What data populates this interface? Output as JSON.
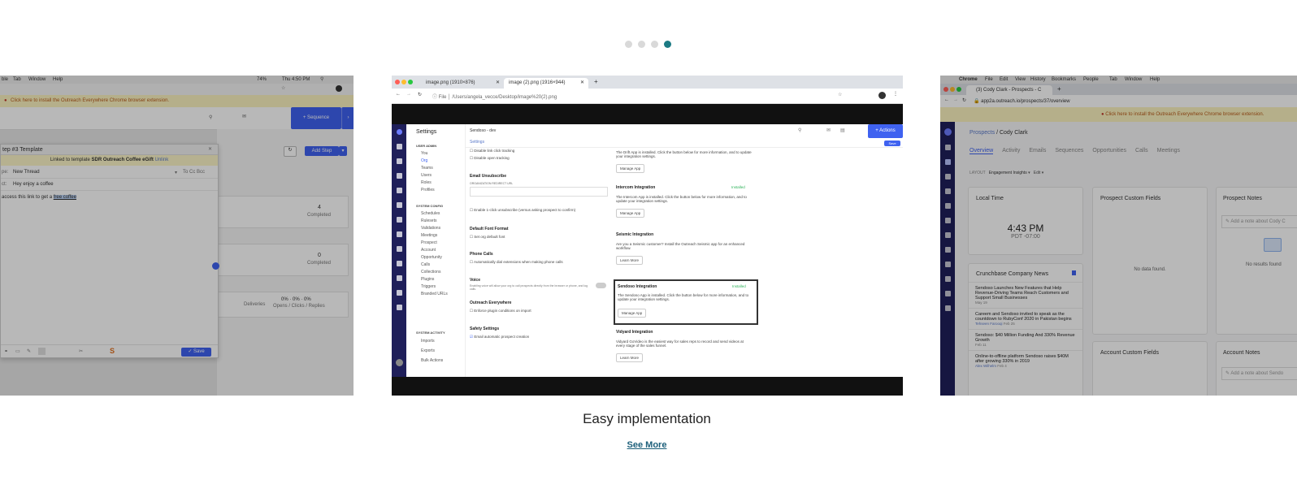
{
  "carousel": {
    "dots": [
      {
        "label": "slide-1",
        "active": false
      },
      {
        "label": "slide-2",
        "active": false
      },
      {
        "label": "slide-3",
        "active": false
      },
      {
        "label": "slide-4",
        "active": true
      }
    ],
    "caption": "Easy implementation",
    "see_more": "See More"
  },
  "left_slide": {
    "menubar": [
      "ble",
      "Tab",
      "Window",
      "Help"
    ],
    "clock": "Thu 4:50 PM",
    "battery": "74%",
    "banner": "Click here to install the Outreach Everywhere Chrome browser extension.",
    "sequence_btn": "+ Sequence",
    "add_step_btn": "Add Step",
    "modal_title": "tep #3 Template",
    "linked_prefix": "Linked to template",
    "linked_template": "SDR Outreach Coffee eGift",
    "unlink": "Unlink",
    "thread_label": "pe:",
    "thread_value": "New Thread",
    "to_cc_bcc": "To  Cc  Bcc",
    "subject_label": "ct:",
    "subject_value": "Hey enjoy a coffee",
    "body_text": "access this link to get a",
    "body_link": "free coffee",
    "save_btn": "✓ Save",
    "stats": [
      {
        "value": "4",
        "label": "Completed"
      },
      {
        "value": "0",
        "label": "Completed"
      }
    ],
    "delivery_row": {
      "deliveries": "Deliveries",
      "values": "0%  ·  0%  ·  0%",
      "labels": "Opens / Clicks / Replies"
    }
  },
  "center_slide": {
    "tabs": [
      "image.png (1910×876)",
      "image (2).png (1916×944)"
    ],
    "url": "/Users/angela_vecce/Desktop/image%20(2).png",
    "settings_title": "Settings",
    "org_name": "Sendoso - dev",
    "breadcrumb": "Settings",
    "actions_btn": "+ Actions",
    "save_btn": "Save",
    "nav_sections": [
      {
        "heading": "USER ADMIN",
        "items": [
          "You",
          "Org",
          "Teams",
          "Users",
          "Roles",
          "Profiles"
        ]
      },
      {
        "heading": "SYSTEM CONFIG",
        "items": [
          "Schedules",
          "Rulesets",
          "Validations",
          "Meetings",
          "Prospect",
          "Account",
          "Opportunity",
          "Calls",
          "Collections",
          "Plugins",
          "Triggers",
          "Branded URLs"
        ]
      },
      {
        "heading": "SYSTEM ACTIVITY",
        "items": [
          "Imports",
          "Exports",
          "Bulk Actions"
        ]
      }
    ],
    "left_settings": [
      {
        "title": "",
        "lines": [
          "Disable link click tracking",
          "Disable open tracking"
        ]
      },
      {
        "title": "Email Unsubscribe",
        "lines": [
          "ORGANIZATION REDIRECT URL",
          "Enable 1-click unsubscribe (versus asking prospect to confirm)"
        ]
      },
      {
        "title": "Default Font Format",
        "lines": [
          "Set org default font"
        ]
      },
      {
        "title": "Phone Calls",
        "lines": [
          "Automatically dial extensions when making phone calls"
        ]
      },
      {
        "title": "Voice",
        "lines": [
          "Enabling voice will allow your org to call prospects directly from the browser or phone, and log calls."
        ]
      },
      {
        "title": "Outreach Everywhere",
        "lines": [
          "Enforce plugin conditions on import"
        ]
      },
      {
        "title": "Safety Settings",
        "lines": [
          "Email automatic prospect creation"
        ]
      }
    ],
    "integrations": [
      {
        "title": "",
        "desc": "The Drift App is installed. Click the button below for more information, and to update your integration settings.",
        "button": "Manage App",
        "status": ""
      },
      {
        "title": "Intercom Integration",
        "desc": "The Intercom App is installed. Click the button below for more information, and to update your integration settings.",
        "button": "Manage App",
        "status": "Installed"
      },
      {
        "title": "Seismic Integration",
        "desc": "Are you a Seismic customer? Install the Outreach Seismic app for an enhanced workflow.",
        "button": "Learn More",
        "status": ""
      },
      {
        "title": "Sendoso Integration",
        "desc": "The Sendoso App is installed. Click the button below for more information, and to update your integration settings.",
        "button": "Manage App",
        "status": "Installed"
      },
      {
        "title": "Vidyard Integration",
        "desc": "Vidyard GoVideo is the easiest way for sales reps to record and send videos at every stage of the sales funnel.",
        "button": "Learn More",
        "status": ""
      }
    ]
  },
  "right_slide": {
    "menubar": [
      "Chrome",
      "File",
      "Edit",
      "View",
      "History",
      "Bookmarks",
      "People",
      "Tab",
      "Window",
      "Help"
    ],
    "tab": "(3) Cody Clark - Prospects - C",
    "url": "app2a.outreach.io/prospects/37/overview",
    "banner": "Click here to install the Outreach Everywhere Chrome browser extension.",
    "breadcrumb_parent": "Prospects",
    "breadcrumb_current": "Cody Clark",
    "tabs": [
      "Overview",
      "Activity",
      "Emails",
      "Sequences",
      "Opportunities",
      "Calls",
      "Meetings"
    ],
    "layout_label": "LAYOUT",
    "layout_value": "Engagement Insights",
    "edit": "Edit",
    "local_time_title": "Local Time",
    "local_time": "4:43 PM",
    "timezone": "PDT -07:00",
    "custom_fields_title": "Prospect Custom Fields",
    "no_data": "No data found.",
    "notes_title": "Prospect Notes",
    "notes_placeholder": "Add a note about Cody C",
    "no_results": "No results found",
    "news_title": "Crunchbase Company News",
    "news": [
      {
        "headline": "Sendoso Launches New Features that Help Revenue-Driving Teams Reach Customers and Support Small Businesses",
        "author": "",
        "date": "May 19"
      },
      {
        "headline": "Careem and Sendoso invited to speak as the countdown to RubyConf 2020 in Pakistan begins",
        "author": "Tehseen Farooqi",
        "date": "Feb 25"
      },
      {
        "headline": "Sendoso: $40 Million Funding And 330% Revenue Growth",
        "author": "",
        "date": "Feb 11"
      },
      {
        "headline": "Online-to-offline platform Sendoso raises $40M after growing 330% in 2019",
        "author": "Alex Wilhelm",
        "date": "Feb 4"
      }
    ],
    "account_custom_fields": "Account Custom Fields",
    "account_notes": "Account Notes",
    "account_notes_placeholder": "Add a note about Sendo"
  }
}
